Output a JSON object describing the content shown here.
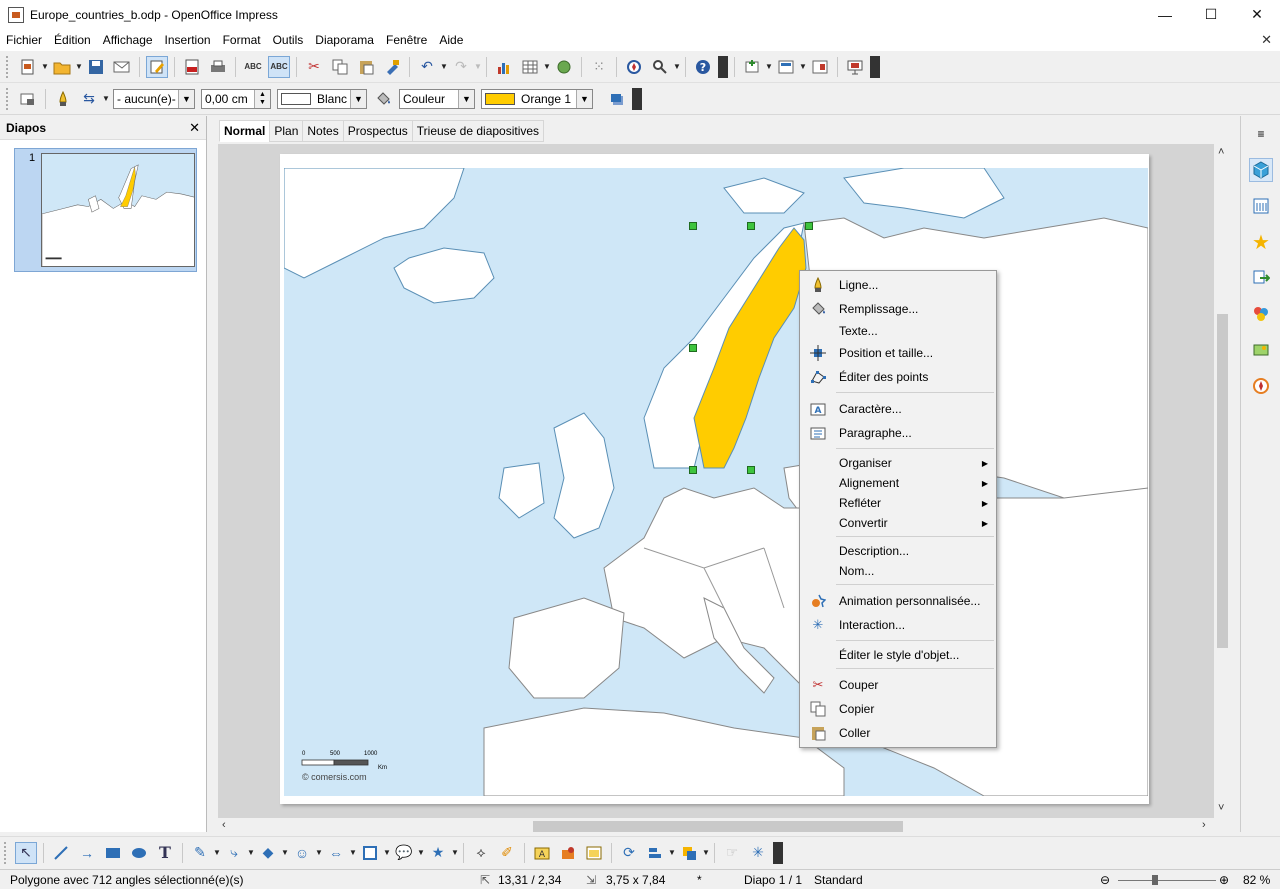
{
  "window": {
    "title": "Europe_countries_b.odp - OpenOffice Impress",
    "minimize": "—",
    "maximize": "☐",
    "close": "✕"
  },
  "menubar": {
    "items": [
      "Fichier",
      "Édition",
      "Affichage",
      "Insertion",
      "Format",
      "Outils",
      "Diaporama",
      "Fenêtre",
      "Aide"
    ],
    "close_doc": "✕"
  },
  "line_toolbar": {
    "arrow_style": "- aucun(e)-",
    "line_width": "0,00 cm",
    "line_color": "Blanc",
    "area_type": "Couleur",
    "area_color": "Orange 1",
    "area_color_hex": "#ffcc00"
  },
  "slides_panel": {
    "title": "Diapos",
    "close": "✕",
    "slide_number": "1"
  },
  "view_tabs": [
    "Normal",
    "Plan",
    "Notes",
    "Prospectus",
    "Trieuse de diapositives"
  ],
  "map": {
    "scale_labels": [
      "0",
      "500",
      "1000"
    ],
    "scale_unit": "Km",
    "credit": "© comersis.com",
    "sea_color": "#cfe7f7",
    "land_color": "#ffffff",
    "selected_color": "#ffcc00"
  },
  "context_menu": {
    "items": [
      {
        "label": "Ligne...",
        "icon": "line-pen-icon"
      },
      {
        "label": "Remplissage...",
        "icon": "fill-bucket-icon"
      },
      {
        "label": "Texte...",
        "icon": ""
      },
      {
        "label": "Position et taille...",
        "icon": "position-size-icon"
      },
      {
        "label": "Éditer des points",
        "icon": "edit-points-icon"
      },
      {
        "label": "Caractère...",
        "icon": "character-icon"
      },
      {
        "label": "Paragraphe...",
        "icon": "paragraph-icon"
      },
      {
        "label": "Organiser",
        "submenu": true
      },
      {
        "label": "Alignement",
        "submenu": true
      },
      {
        "label": "Refléter",
        "submenu": true
      },
      {
        "label": "Convertir",
        "submenu": true
      },
      {
        "label": "Description...",
        "icon": ""
      },
      {
        "label": "Nom...",
        "icon": ""
      },
      {
        "label": "Animation personnalisée...",
        "icon": "custom-animation-icon"
      },
      {
        "label": "Interaction...",
        "icon": "interaction-icon"
      },
      {
        "label": "Éditer le style d'objet...",
        "icon": ""
      },
      {
        "label": "Couper",
        "icon": "scissors-icon"
      },
      {
        "label": "Copier",
        "icon": "copy-icon"
      },
      {
        "label": "Coller",
        "icon": "paste-icon"
      }
    ]
  },
  "statusbar": {
    "selection": "Polygone avec 712 angles sélectionné(e)(s)",
    "position": "13,31 / 2,34",
    "size": "3,75 x 7,84",
    "modified": "*",
    "slide": "Diapo 1 / 1",
    "layout": "Standard",
    "zoom": "82 %"
  }
}
